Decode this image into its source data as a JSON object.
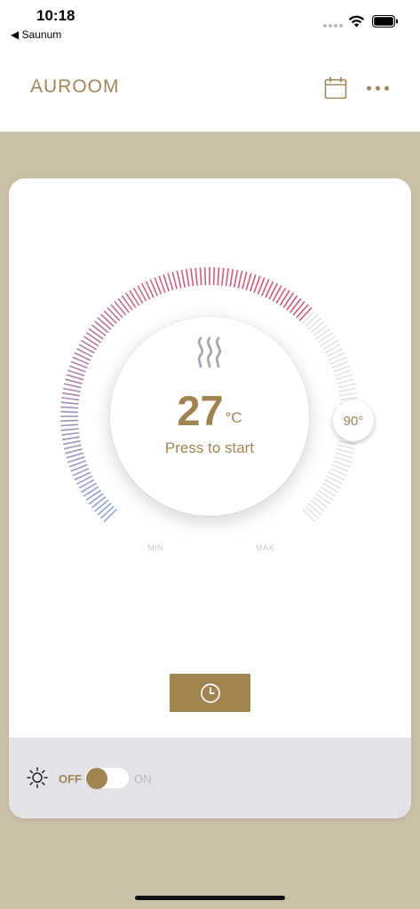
{
  "status_bar": {
    "time": "10:18",
    "back_app": "◀ Saunum",
    "icons": [
      "cellular-dots-icon",
      "wifi-icon",
      "battery-icon"
    ]
  },
  "header": {
    "brand": "AUROOM",
    "actions": [
      "calendar-icon",
      "more-icon"
    ]
  },
  "dial": {
    "temperature": "27",
    "unit": "°C",
    "status": "Press to start",
    "set_temperature": "90°",
    "min_label": "MIN",
    "max_label": "MAX",
    "scale_colors": {
      "cold": "#8fa6d8",
      "hot": "#cf5a78",
      "inactive": "#e3e3e3"
    }
  },
  "timer": {
    "icon": "clock-icon"
  },
  "light": {
    "icon": "sun-icon",
    "off_label": "OFF",
    "on_label": "ON",
    "state": "off"
  },
  "colors": {
    "accent": "#9f8452",
    "background": "#ccbfa8",
    "panel": "#e2e2e7"
  }
}
